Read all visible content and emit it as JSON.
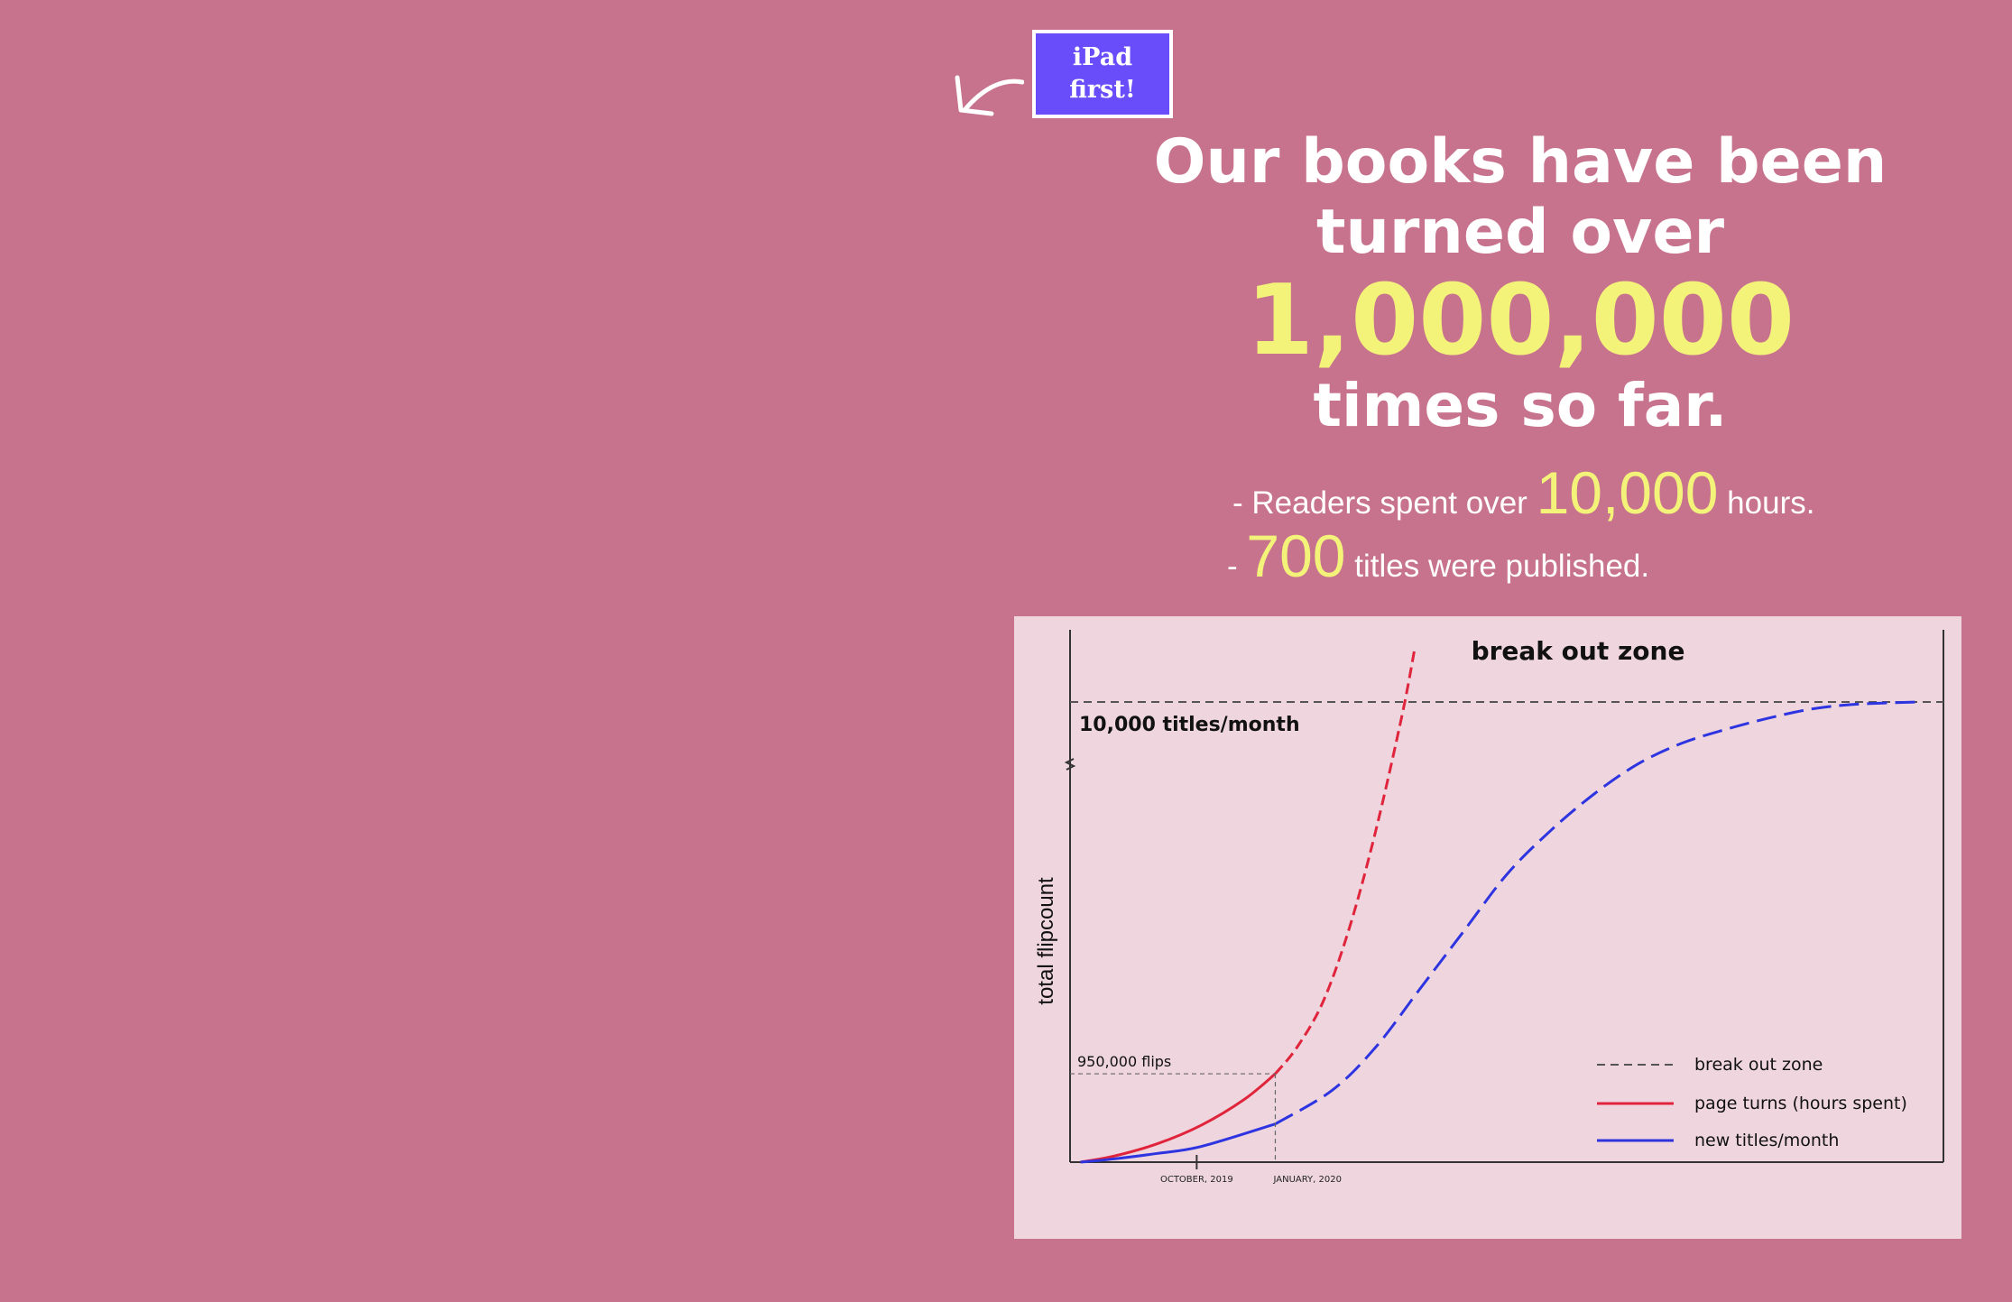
{
  "badge": {
    "text": "iPad\nfirst!"
  },
  "headline": {
    "line1": "Our books have been",
    "line2": "turned over",
    "big_number": "1,000,000",
    "line3": "times so far."
  },
  "stats": [
    {
      "prefix": "- Readers spent over",
      "value": "10,000",
      "suffix": "hours."
    },
    {
      "prefix": "-",
      "value": "700",
      "suffix": "titles were published."
    }
  ],
  "colors": {
    "background": "#c8738e",
    "highlight": "#f3f37a",
    "badge": "#6a4dfa",
    "chart_background": "#efd6de",
    "red_series": "#e0243c",
    "blue_series": "#2d34e0",
    "break_out_line": "#555555"
  },
  "icons": {
    "arrow": "hand-drawn-arrow-icon"
  },
  "chart_data": {
    "type": "line",
    "title": "",
    "ylabel": "total flipcount",
    "xlabel": "",
    "x_tick_labels": [
      "OCTOBER, 2019",
      "JANUARY, 2020"
    ],
    "annotations": {
      "zone_label": "break out zone",
      "threshold_label": "10,000 titles/month",
      "point_label": "950,000 flips"
    },
    "legend_position": "bottom-right",
    "grid": false,
    "y_axis_break": true,
    "series": [
      {
        "name": "break out zone",
        "style": "dashed",
        "color": "#555555",
        "x": [
          0,
          1
        ],
        "y": [
          1.0,
          1.0
        ]
      },
      {
        "name": "page turns (hours spent)",
        "style": "solid-then-dashed",
        "color": "#e0243c",
        "x": [
          0.012,
          0.05,
          0.1,
          0.15,
          0.2,
          0.235,
          0.26,
          0.29,
          0.32,
          0.35,
          0.38,
          0.395
        ],
        "y": [
          0.0,
          0.013,
          0.04,
          0.08,
          0.137,
          0.192,
          0.25,
          0.35,
          0.51,
          0.72,
          0.97,
          1.12
        ],
        "solid_until_x": 0.235
      },
      {
        "name": "new titles/month",
        "style": "solid-then-dashed",
        "color": "#2d34e0",
        "x": [
          0.012,
          0.05,
          0.1,
          0.15,
          0.235,
          0.3,
          0.35,
          0.4,
          0.45,
          0.5,
          0.55,
          0.6,
          0.65,
          0.7,
          0.75,
          0.8,
          0.85,
          0.9,
          0.97
        ],
        "y": [
          0.0,
          0.007,
          0.019,
          0.034,
          0.083,
          0.156,
          0.25,
          0.375,
          0.5,
          0.625,
          0.72,
          0.8,
          0.865,
          0.91,
          0.94,
          0.965,
          0.985,
          0.995,
          1.0
        ],
        "solid_until_x": 0.28
      }
    ]
  }
}
